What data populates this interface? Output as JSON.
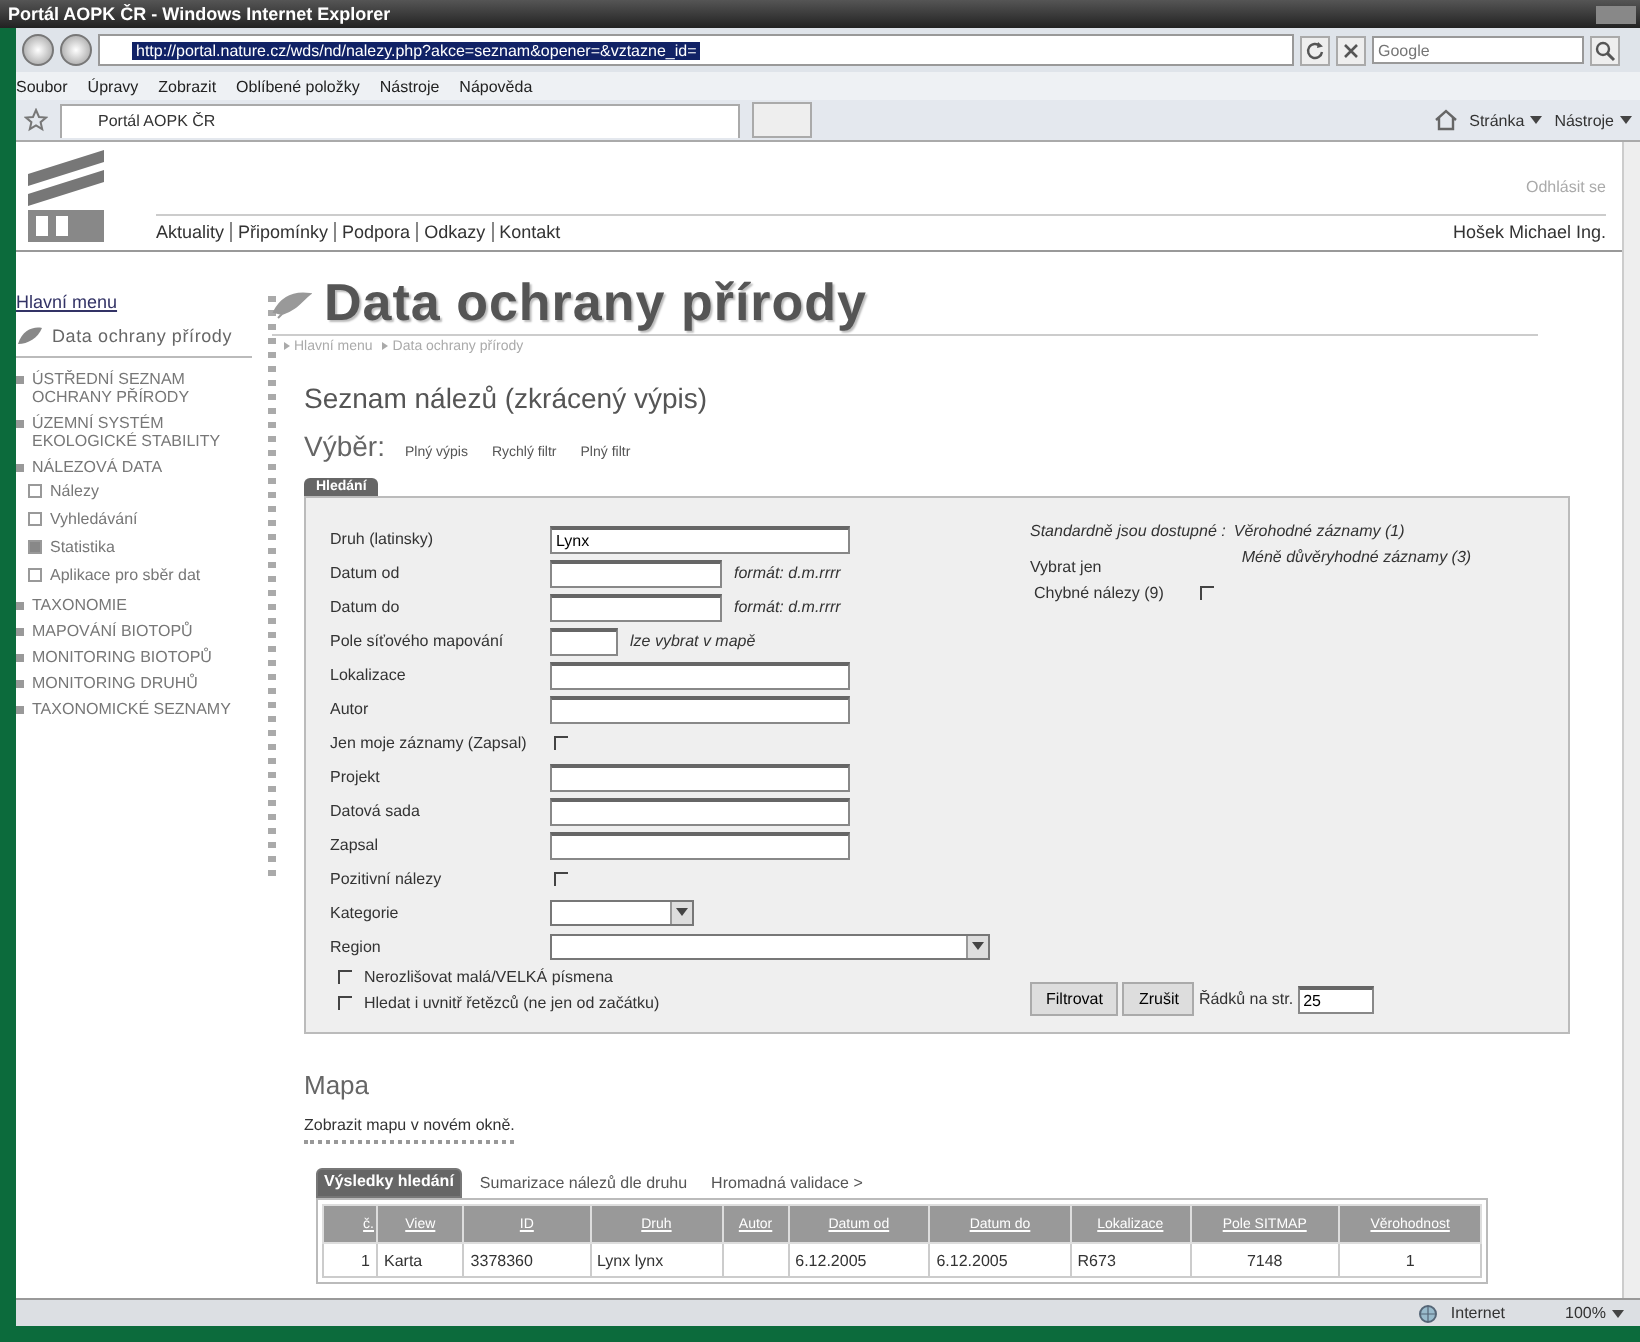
{
  "browser": {
    "title": "Portál AOPK ČR - Windows Internet Explorer",
    "url": "http://portal.nature.cz/wds/nd/nalezy.php?akce=seznam&opener=&vztazne_id=",
    "search": {
      "placeholder": "Google"
    },
    "menu": [
      "Soubor",
      "Úpravy",
      "Zobrazit",
      "Oblíbené položky",
      "Nástroje",
      "Nápověda"
    ],
    "tab": "Portál AOPK ČR",
    "tools": [
      "Stránka",
      "Nástroje"
    ]
  },
  "header": {
    "logout": "Odhlásit se",
    "nav": [
      "Aktuality",
      "Připomínky",
      "Podpora",
      "Odkazy",
      "Kontakt"
    ],
    "user": "Hošek Michael Ing."
  },
  "sidebar": {
    "main_menu": "Hlavní menu",
    "section": "Data ochrany přírody",
    "items": [
      {
        "label": "ÚSTŘEDNÍ SEZNAM OCHRANY PŘÍRODY"
      },
      {
        "label": "ÚZEMNÍ SYSTÉM EKOLOGICKÉ STABILITY"
      },
      {
        "label": "NÁLEZOVÁ DATA",
        "children": [
          {
            "label": "Nálezy",
            "expandable": false
          },
          {
            "label": "Vyhledávání",
            "expandable": false
          },
          {
            "label": "Statistika",
            "expandable": true
          },
          {
            "label": "Aplikace pro sběr dat",
            "expandable": false
          }
        ]
      },
      {
        "label": "TAXONOMIE"
      },
      {
        "label": "MAPOVÁNÍ BIOTOPŮ"
      },
      {
        "label": "MONITORING BIOTOPŮ"
      },
      {
        "label": "MONITORING DRUHŮ"
      },
      {
        "label": "TAXONOMICKÉ SEZNAMY"
      }
    ]
  },
  "main": {
    "title": "Data ochrany přírody",
    "breadcrumb": [
      "Hlavní menu",
      "Data ochrany přírody"
    ],
    "subtitle": "Seznam nálezů (zkrácený výpis)",
    "choice_label": "Výběr:",
    "choices": [
      "Plný výpis",
      "Rychlý filtr",
      "Plný filtr"
    ],
    "search_tab": "Hledání"
  },
  "form": {
    "fields": [
      {
        "label": "Druh (latinsky)",
        "kind": "long-text",
        "value": "Lynx"
      },
      {
        "label": "Datum od",
        "kind": "medium-text",
        "hint": "formát: d.m.rrrr"
      },
      {
        "label": "Datum do",
        "kind": "medium-text",
        "hint": "formát: d.m.rrrr"
      },
      {
        "label": "Pole síťového mapování",
        "kind": "small-text",
        "hint": "lze vybrat v mapě"
      },
      {
        "label": "Lokalizace",
        "kind": "long-text"
      },
      {
        "label": "Autor",
        "kind": "long-text"
      },
      {
        "label": "Jen moje záznamy (Zapsal)",
        "kind": "checkbox",
        "checked": false
      },
      {
        "label": "Projekt",
        "kind": "long-text"
      },
      {
        "label": "Datová sada",
        "kind": "long-text"
      },
      {
        "label": "Zapsal",
        "kind": "long-text"
      },
      {
        "label": "Pozitivní nálezy",
        "kind": "checkbox",
        "checked": false
      },
      {
        "label": "Kategorie",
        "kind": "short-select"
      },
      {
        "label": "Region",
        "kind": "wide-select"
      }
    ],
    "options": [
      {
        "label": "Nerozlišovat malá/VELKÁ písmena",
        "checked": false
      },
      {
        "label": "Hledat i uvnitř řetězců (ne jen od začátku)",
        "checked": false
      }
    ],
    "note_label": "Standardně jsou dostupné :",
    "notes": [
      "Věrohodné záznamy (1)",
      "Méně důvěryhodné záznamy (3)"
    ],
    "select_only": "Vybrat jen",
    "error_option": {
      "label": "Chybné nálezy (9)",
      "checked": false
    },
    "buttons": [
      "Filtrovat",
      "Zrušit"
    ],
    "rows_label": "Řádků na str.",
    "rows_value": "25"
  },
  "map": {
    "heading": "Mapa",
    "link": "Zobrazit mapu v novém okně."
  },
  "results": {
    "tabs": [
      {
        "label": "Výsledky hledání",
        "selected": true
      },
      {
        "label": "Sumarizace nálezů dle druhu",
        "selected": false
      },
      {
        "label": "Hromadná validace >",
        "selected": false
      }
    ],
    "columns": [
      "č.",
      "View",
      "ID",
      "Druh",
      "Autor",
      "Datum od",
      "Datum do",
      "Lokalizace",
      "Pole SITMAP",
      "Věrohodnost"
    ],
    "rows": [
      [
        "1",
        "Karta",
        "3378360",
        "Lynx lynx",
        null,
        "6.12.2005",
        "6.12.2005",
        "R673",
        "7148",
        "1"
      ]
    ]
  },
  "status_bar": {
    "zone": "Internet",
    "zoom": "100%"
  }
}
